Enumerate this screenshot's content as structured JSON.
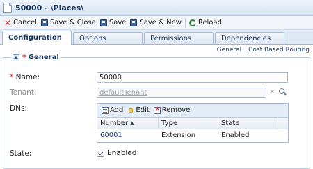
{
  "window": {
    "title": "50000 - \\Places\\"
  },
  "toolbar": {
    "cancel": "Cancel",
    "save_close": "Save & Close",
    "save": "Save",
    "save_new": "Save & New",
    "reload": "Reload"
  },
  "tabs": [
    {
      "label": "Configuration",
      "active": true
    },
    {
      "label": "Options"
    },
    {
      "label": "Permissions"
    },
    {
      "label": "Dependencies"
    }
  ],
  "section_links": {
    "general": "General",
    "cost_routing": "Cost Based Routing"
  },
  "general": {
    "title": "General",
    "name_label": "Name:",
    "name_value": "50000",
    "tenant_label": "Tenant:",
    "tenant_value": "defaultTenant",
    "dns_label": "DNs:",
    "state_label": "State:",
    "state_checked": true,
    "state_value": "Enabled"
  },
  "dns_grid": {
    "add": "Add",
    "edit": "Edit",
    "remove": "Remove",
    "columns": [
      "Number",
      "Type",
      "State"
    ],
    "rows": [
      {
        "number": "60001",
        "type": "Extension",
        "state": "Enabled"
      }
    ]
  },
  "colors": {
    "accent": "#15325c",
    "link": "#1a3f7a",
    "required": "#dd2222"
  }
}
